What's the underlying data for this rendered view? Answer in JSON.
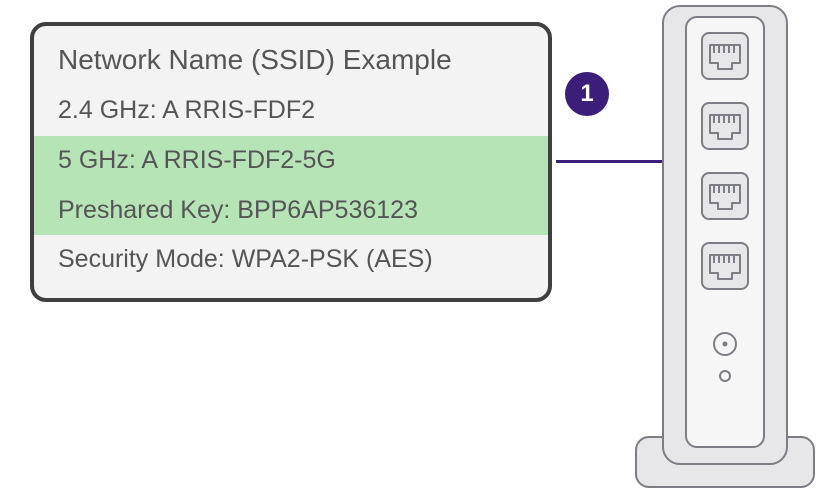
{
  "card": {
    "title": "Network Name (SSID) Example",
    "rows": [
      {
        "label": "2.4 GHz:",
        "value": "A RRIS-FDF2",
        "highlight": false
      },
      {
        "label": "5 GHz:",
        "value": "A RRIS-FDF2-5G",
        "highlight": true
      },
      {
        "label": "Preshared Key:",
        "value": "BPP6AP536123",
        "highlight": true
      },
      {
        "label": "Security Mode:",
        "value": "WPA2-PSK (AES)",
        "highlight": false
      }
    ]
  },
  "step": "1",
  "colors": {
    "accent": "#3A1E7A",
    "highlight": "#B6E4B6"
  }
}
